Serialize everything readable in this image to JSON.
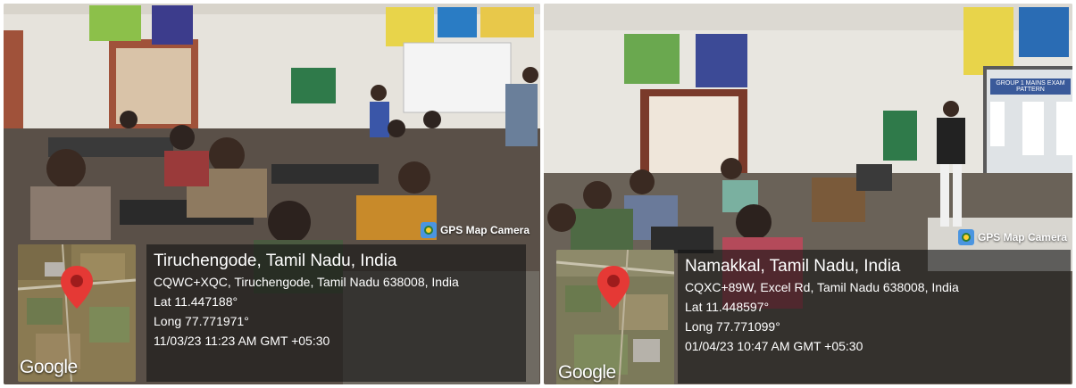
{
  "photos": [
    {
      "badge": "GPS Map Camera",
      "map_watermark": "Google",
      "place": "Tiruchengode, Tamil Nadu, India",
      "address": "CQWC+XQC, Tiruchengode, Tamil Nadu 638008, India",
      "lat": "Lat 11.447188°",
      "long": "Long 77.771971°",
      "datetime": "11/03/23 11:23 AM GMT +05:30"
    },
    {
      "badge": "GPS Map Camera",
      "map_watermark": "Google",
      "place": "Namakkal, Tamil Nadu, India",
      "address": "CQXC+89W, Excel Rd, Tamil Nadu 638008, India",
      "lat": "Lat 11.448597°",
      "long": "Long 77.771099°",
      "datetime": "01/04/23 10:47 AM GMT +05:30",
      "screen_text": "GROUP 1 MAINS EXAM PATTERN"
    }
  ],
  "colors": {
    "panel": "#141414",
    "pin": "#e53935",
    "badge_logo": "#4b95e0"
  }
}
